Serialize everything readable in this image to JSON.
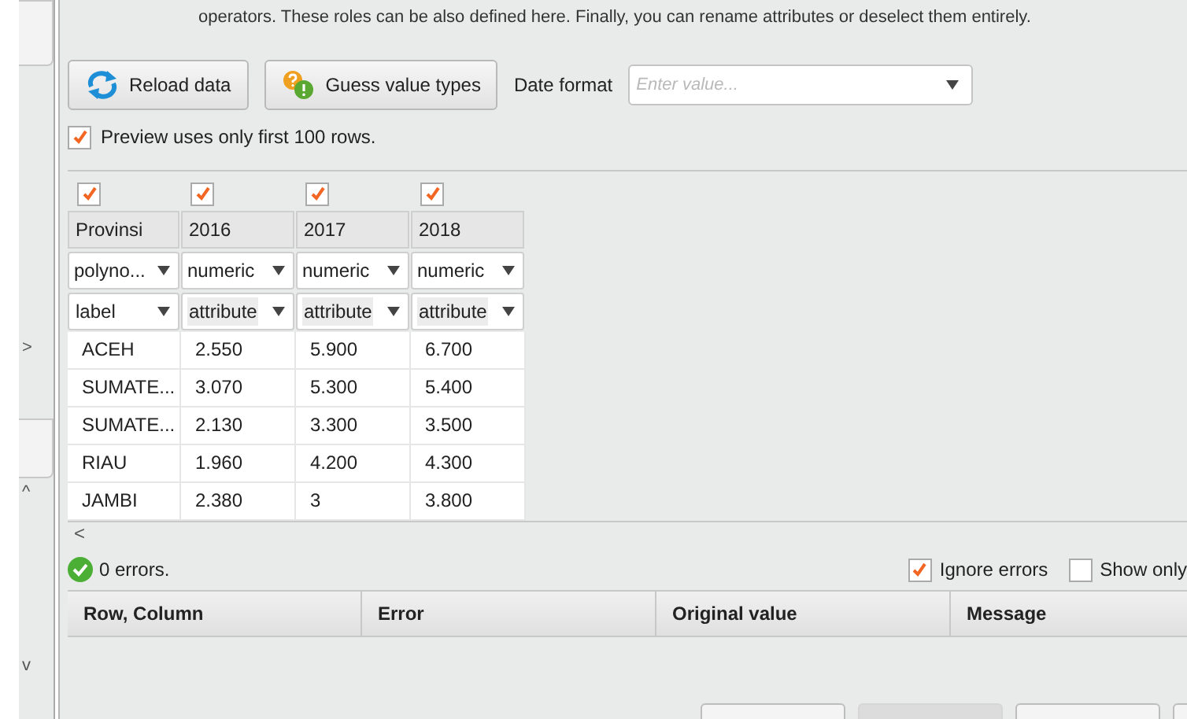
{
  "intro_text": "operators. These roles can be also defined here. Finally, you can rename attributes or deselect them entirely.",
  "toolbar": {
    "reload_button": "Reload data",
    "guess_button": "Guess value types",
    "date_format_label": "Date format",
    "date_format_placeholder": "Enter value..."
  },
  "preview_option": {
    "label": "Preview uses only first 100 rows.",
    "checked": true
  },
  "table": {
    "columns": [
      {
        "name": "Provinsi",
        "checked": true,
        "type": "polyno...",
        "role": "label",
        "kind": "special"
      },
      {
        "name": "2016",
        "checked": true,
        "type": "numeric",
        "role": "attribute",
        "kind": "regular"
      },
      {
        "name": "2017",
        "checked": true,
        "type": "numeric",
        "role": "attribute",
        "kind": "regular"
      },
      {
        "name": "2018",
        "checked": true,
        "type": "numeric",
        "role": "attribute",
        "kind": "regular"
      }
    ],
    "rows": [
      [
        "ACEH",
        "2.550",
        "5.900",
        "6.700"
      ],
      [
        "SUMATE...",
        "3.070",
        "5.300",
        "5.400"
      ],
      [
        "SUMATE...",
        "2.130",
        "3.300",
        "3.500"
      ],
      [
        "RIAU",
        "1.960",
        "4.200",
        "4.300"
      ],
      [
        "JAMBI",
        "2.380",
        "3",
        "3.800"
      ]
    ],
    "scroll_left": "<"
  },
  "status": {
    "errors": "0 errors.",
    "ignore_errors": {
      "label": "Ignore errors",
      "checked": true
    },
    "show_only": {
      "label": "Show only",
      "checked": false
    }
  },
  "error_table": {
    "columns": [
      "Row, Column",
      "Error",
      "Original value",
      "Message"
    ]
  },
  "sidebar": {
    "expand_arrow": ">",
    "scroll_up": "^",
    "scroll_down": "v"
  },
  "bottom_buttons": [
    {
      "disabled": false
    },
    {
      "disabled": true
    },
    {
      "disabled": false
    },
    {
      "disabled": false
    }
  ]
}
